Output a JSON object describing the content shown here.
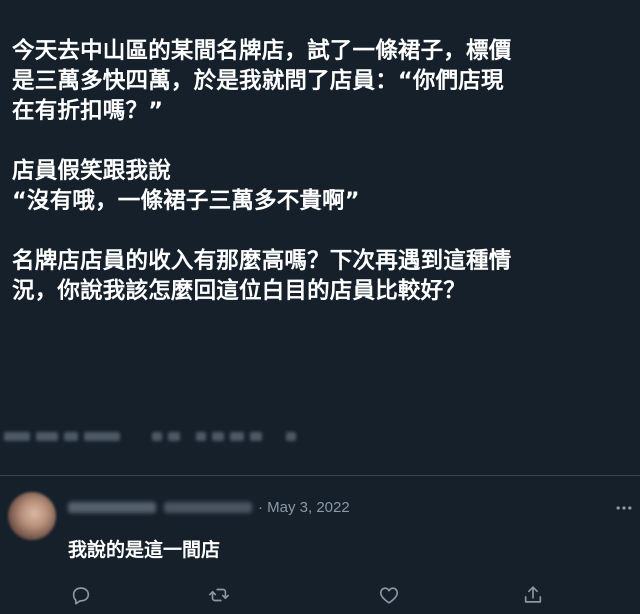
{
  "tweet": {
    "lines": [
      "今天去中山區的某間名牌店，試了一條裙子，標價",
      "是三萬多快四萬，於是我就問了店員：“你們店現",
      "在有折扣嗎？”",
      "店員假笑跟我說",
      "“沒有哦，一條裙子三萬多不貴啊”",
      "名牌店店員的收入有那麼高嗎？下次再遇到這種情",
      "況，你說我該怎麼回這位白目的店員比較好？"
    ]
  },
  "reply": {
    "date": "· May 3, 2022",
    "text": "我說的是這一間店"
  },
  "icons": {
    "reply": "reply-icon",
    "retweet": "retweet-icon",
    "like": "like-icon",
    "share": "share-icon",
    "more": "more-icon"
  },
  "colors": {
    "background": "#15202b",
    "text": "#ffffff",
    "secondary": "#8b98a5",
    "divider": "#38444d"
  }
}
